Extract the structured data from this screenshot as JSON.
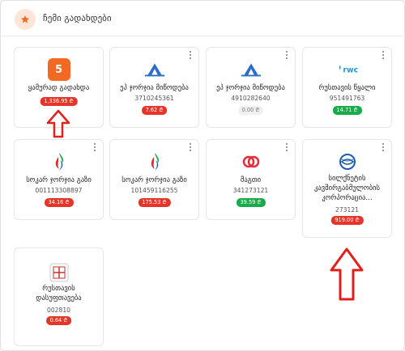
{
  "header": {
    "title": "ჩემი გადახდები",
    "icon": "star-icon",
    "accent": "#f26a22"
  },
  "cards": [
    {
      "name": "ყამურად გადახდა",
      "number_tile": "5",
      "amount": "1,336.95 ₾",
      "status": "red"
    },
    {
      "name": "ეპ ჯორჯია მიწოდება",
      "account": "3710245361",
      "amount": "7.62 ₾",
      "status": "red",
      "logo": "epg-logo"
    },
    {
      "name": "ეპ ჯორჯია მიწოდება",
      "account": "4910282640",
      "amount": "0.00 ₾",
      "status": "gray",
      "logo": "epg-logo"
    },
    {
      "name": "რუსთავის წყალი",
      "account": "951491763",
      "amount": "14.71 ₾",
      "status": "green",
      "logo": "rwc-logo",
      "logo_text": "rwc"
    },
    {
      "name": "სოკარ ჯორჯია გაზი",
      "account": "001113308897",
      "amount": "34.16 ₾",
      "status": "red",
      "logo": "socar-logo"
    },
    {
      "name": "სოკარ ჯორჯია გაზი",
      "account": "101459116255",
      "amount": "175.53 ₾",
      "status": "red",
      "logo": "socar-logo"
    },
    {
      "name": "მაგთი",
      "account": "341273121",
      "amount": "39.59 ₾",
      "status": "green",
      "logo": "magti-logo"
    },
    {
      "name": "სილქნეტის კავშირგაბმულობის კორპორაცია...",
      "name_lines": [
        "სილქნეტის",
        "კავშირგაბმულობის",
        "კორპორაცია..."
      ],
      "account": "273121",
      "amount": "919.00 ₾",
      "status": "red",
      "logo": "silknet-logo"
    },
    {
      "name": "რუსთავის დასუფთავება",
      "name_lines": [
        "რუსთავის",
        "დასუფთავება"
      ],
      "account": "002810",
      "amount": "0.64 ₾",
      "status": "red",
      "logo": "rustavi-cleaning-logo"
    }
  ],
  "colors": {
    "red": "#e53529",
    "green": "#19ab4a",
    "arrow": "#e0201b"
  }
}
